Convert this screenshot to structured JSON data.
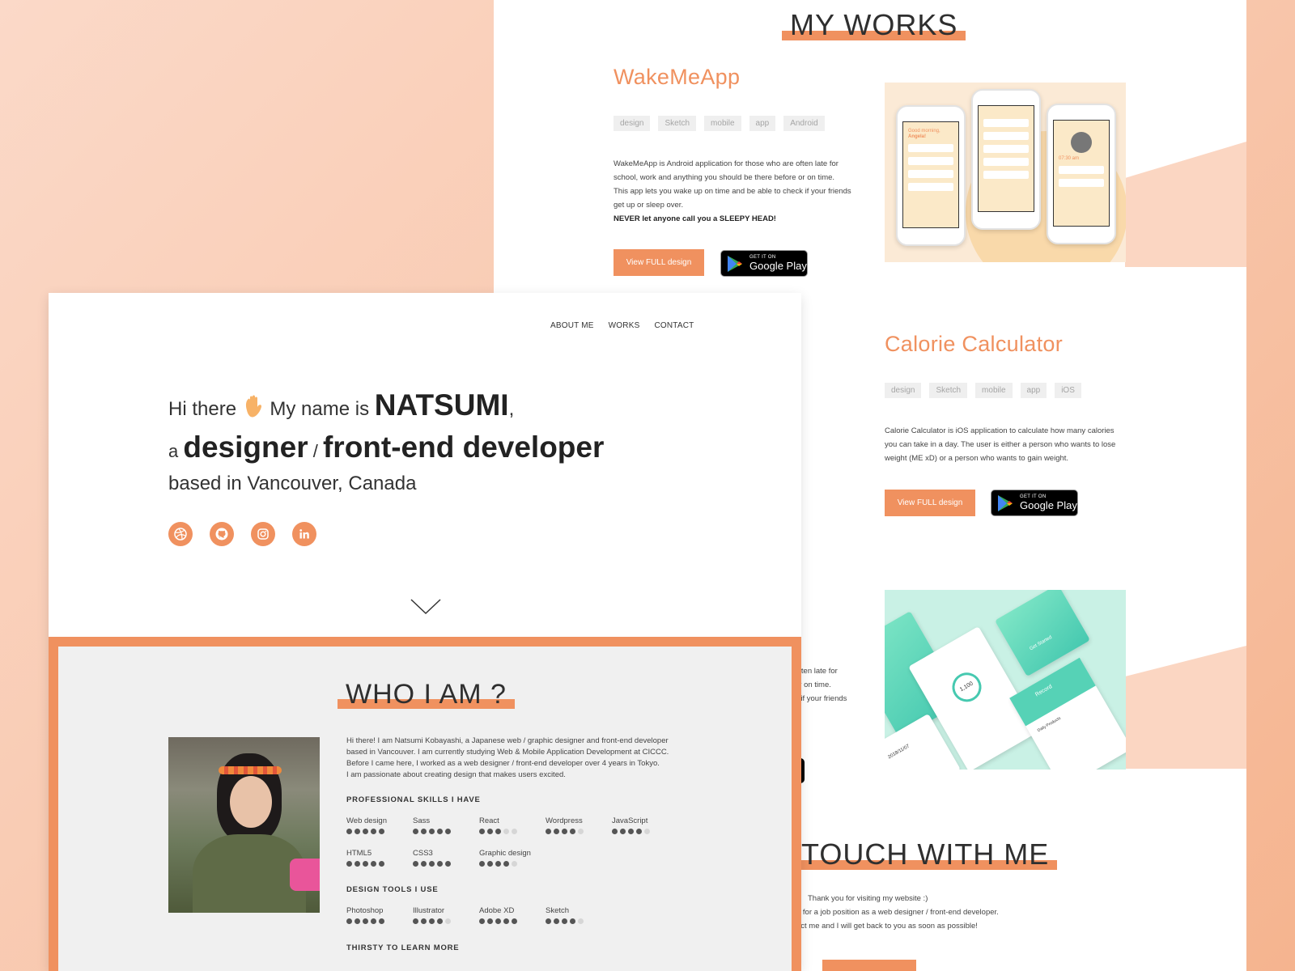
{
  "colors": {
    "accent": "#f0915f",
    "bg_peach": "#f8c6ab",
    "band": "#fbd6c2"
  },
  "works_page": {
    "section_title": "MY WORKS",
    "projects": [
      {
        "title": "WakeMeApp",
        "tags": [
          "design",
          "Sketch",
          "mobile",
          "app",
          "Android"
        ],
        "description": [
          "WakeMeApp is Android application for those who are often late for",
          "school, work and anything you should be there before or on time.",
          "This app lets you wake up on time and be able to check if your friends",
          "get up or sleep over."
        ],
        "description_bold": "NEVER let anyone call you a SLEEPY HEAD!",
        "button": "View FULL design",
        "store_small": "GET IT ON",
        "store_big": "Google Play"
      },
      {
        "title": "Calorie Calculator",
        "tags": [
          "design",
          "Sketch",
          "mobile",
          "app",
          "iOS"
        ],
        "description": [
          "Calorie Calculator is iOS application to calculate how many calories",
          "you can take in a day. The user is either a person who wants to lose",
          "weight (ME xD) or a person who wants to gain weight."
        ],
        "button": "View FULL design",
        "store_small": "GET IT ON",
        "store_big": "Google Play"
      }
    ],
    "partial_desc": [
      "often late for",
      "or on time.",
      "k if your friends"
    ],
    "contact_title": "TOUCH WITH ME",
    "contact_lines": [
      "Thank you for visiting my website :)",
      "g for a job position as a web designer / front-end developer.",
      "act me and I will get back to you as soon as possible!"
    ],
    "phone_texts": {
      "greet": "Good morning,",
      "name": "Angela!",
      "alarm": "07:30 am",
      "kcal": "1,100",
      "date": "2018/11/07",
      "goal": "Daily Products",
      "start": "Get Started",
      "record": "Record"
    }
  },
  "front_page": {
    "nav": [
      "ABOUT ME",
      "WORKS",
      "CONTACT"
    ],
    "hero": {
      "hi": "Hi there",
      "name_pre": "My name is",
      "name": "NATSUMI",
      "comma": ",",
      "a": "a",
      "designer": "designer",
      "slash": "/",
      "dev": "front-end developer",
      "location": "based in Vancouver, Canada"
    },
    "social_icons": [
      "dribbble-icon",
      "github-icon",
      "instagram-icon",
      "linkedin-icon"
    ],
    "who": {
      "title": "WHO I AM ?",
      "bio": [
        "Hi there! I am Natsumi Kobayashi, a Japanese web / graphic designer and front-end developer",
        "based in Vancouver. I am currently studying Web & Mobile Application Development at CICCC.",
        "Before I came here, I worked as a web designer / front-end developer over 4 years in Tokyo.",
        "I am passionate about creating design that makes users excited."
      ],
      "skills_heading": "PROFESSIONAL SKILLS I HAVE",
      "skills": [
        {
          "name": "Web design",
          "level": 5
        },
        {
          "name": "Sass",
          "level": 5
        },
        {
          "name": "React",
          "level": 3
        },
        {
          "name": "Wordpress",
          "level": 4
        },
        {
          "name": "JavaScript",
          "level": 4
        },
        {
          "name": "HTML5",
          "level": 5
        },
        {
          "name": "CSS3",
          "level": 5
        },
        {
          "name": "Graphic design",
          "level": 4
        }
      ],
      "tools_heading": "DESIGN TOOLS I USE",
      "tools": [
        {
          "name": "Photoshop",
          "level": 5
        },
        {
          "name": "Illustrator",
          "level": 4
        },
        {
          "name": "Adobe XD",
          "level": 5
        },
        {
          "name": "Sketch",
          "level": 4
        }
      ],
      "learn_heading": "THIRSTY TO LEARN MORE"
    }
  }
}
